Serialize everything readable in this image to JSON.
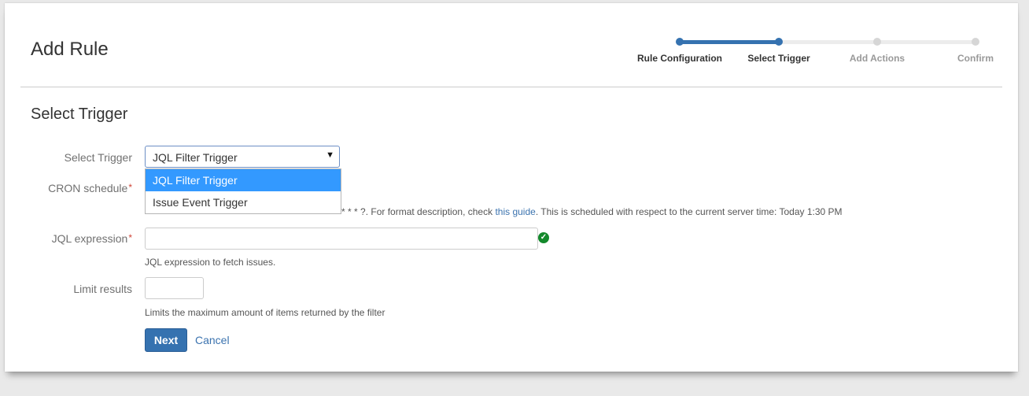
{
  "header": {
    "title": "Add Rule"
  },
  "progress": {
    "steps": [
      {
        "label": "Rule Configuration",
        "state": "done"
      },
      {
        "label": "Select Trigger",
        "state": "current"
      },
      {
        "label": "Add Actions",
        "state": "todo"
      },
      {
        "label": "Confirm",
        "state": "todo"
      }
    ],
    "colors": {
      "active": "#3572b0",
      "inactive": "#d6d6d6"
    }
  },
  "section": {
    "title": "Select Trigger"
  },
  "form": {
    "trigger": {
      "label": "Select Trigger",
      "value": "JQL Filter Trigger",
      "options": [
        "JQL Filter Trigger",
        "Issue Event Trigger"
      ]
    },
    "cron": {
      "label": "CRON schedule",
      "required_mark": "*",
      "help_visible": "* * * * ?. For format description, check",
      "help_link": "this guide",
      "help_after": ". This is scheduled with respect to the current server time: Today 1:30 PM"
    },
    "jql": {
      "label": "JQL expression",
      "required_mark": "*",
      "value": "",
      "help": "JQL expression to fetch issues.",
      "valid_icon": "check-circle-icon"
    },
    "limit": {
      "label": "Limit results",
      "value": "",
      "help": "Limits the maximum amount of items returned by the filter"
    }
  },
  "actions": {
    "next_label": "Next",
    "cancel_label": "Cancel"
  }
}
